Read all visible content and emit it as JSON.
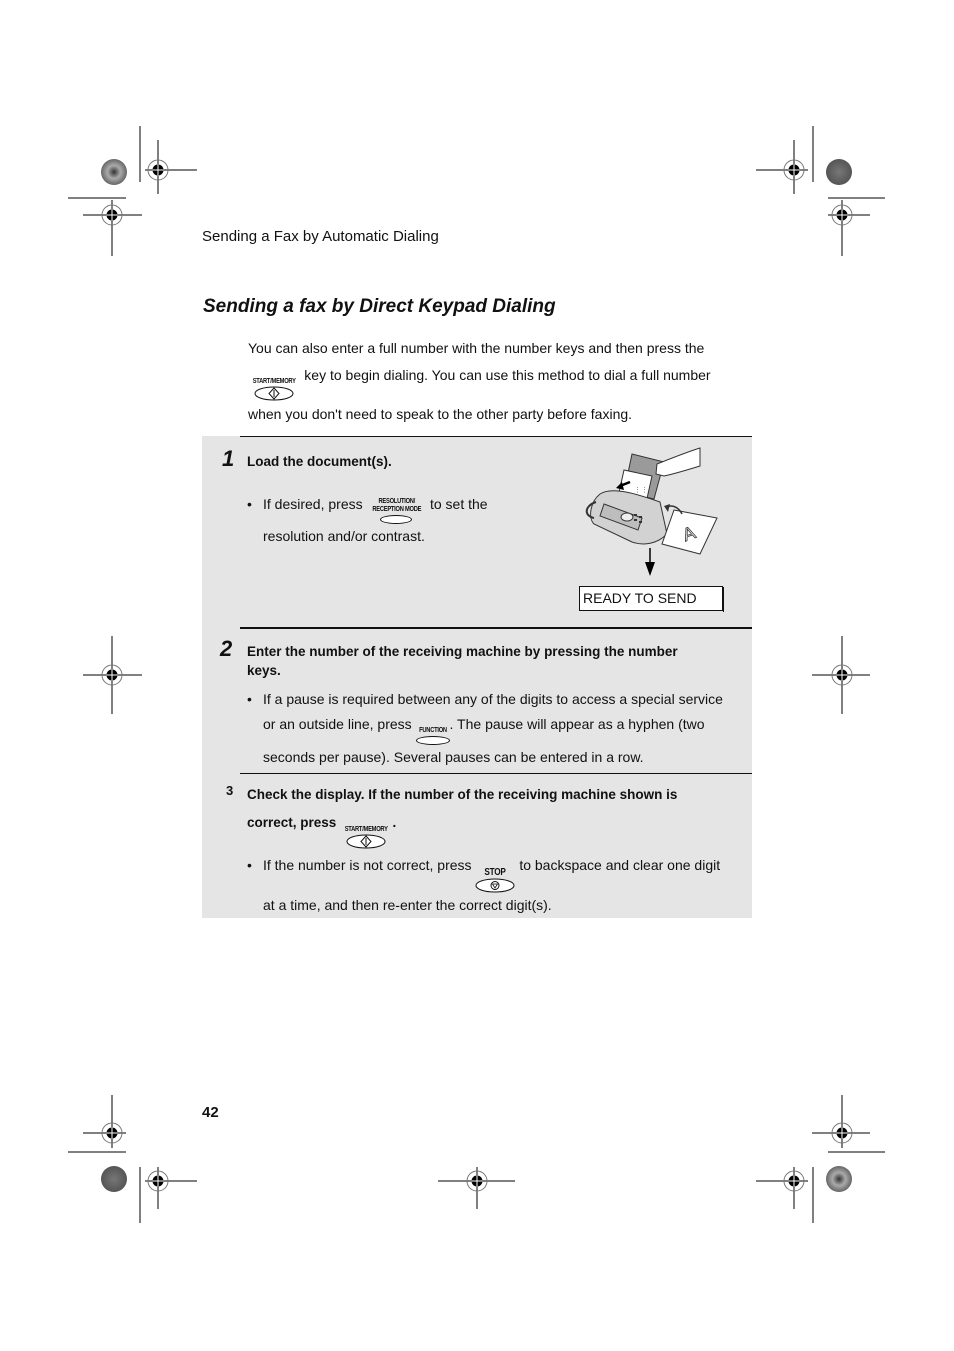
{
  "header": {
    "running_head": "Sending a Fax by Automatic Dialing"
  },
  "section": {
    "title": "Sending a fax by Direct Keypad Dialing",
    "intro_line1": "You can also enter a full number with the number keys and then press the",
    "intro_key": "START/MEMORY",
    "intro_line2": " key to begin dialing. You can use this method to dial a full number",
    "intro_line3": "when you don't need to speak to the other party before faxing."
  },
  "steps": [
    {
      "number": "1",
      "title": "Load the document(s).",
      "bullet_pre": "If desired, press ",
      "bullet_key_top": "RESOLUTION/",
      "bullet_key_bottom": "RECEPTION MODE",
      "bullet_post": " to set the",
      "bullet_line2": "resolution and/or contrast.",
      "display_text": "READY TO SEND",
      "illustration": "fax-machine-loading-document",
      "document_letter": "A"
    },
    {
      "number": "2",
      "title_line1": "Enter the number of the receiving machine by pressing the number",
      "title_line2": "keys.",
      "bullet_line1": "If a pause is required between any of the digits to access a special service",
      "bullet_pre": "or an outside line, press ",
      "bullet_key": "FUNCTION",
      "bullet_post": ". The pause will appear as a hyphen (two",
      "bullet_line3": "seconds per pause). Several pauses can be entered in a row."
    },
    {
      "number": "3",
      "title_line1": "Check the display. If the number of the receiving machine shown is",
      "title_pre": "correct, press ",
      "title_key": "START/MEMORY",
      "title_post": ".",
      "bullet_pre": "If the number is not correct, press ",
      "bullet_key": "STOP",
      "bullet_post": " to backspace and clear one digit",
      "bullet_line2": "at a time, and then re-enter the correct digit(s)."
    }
  ],
  "bullet_glyph": "•",
  "footer": {
    "page_number": "42"
  },
  "print_marks": {
    "registration_marks": 12,
    "color_targets": 4
  }
}
